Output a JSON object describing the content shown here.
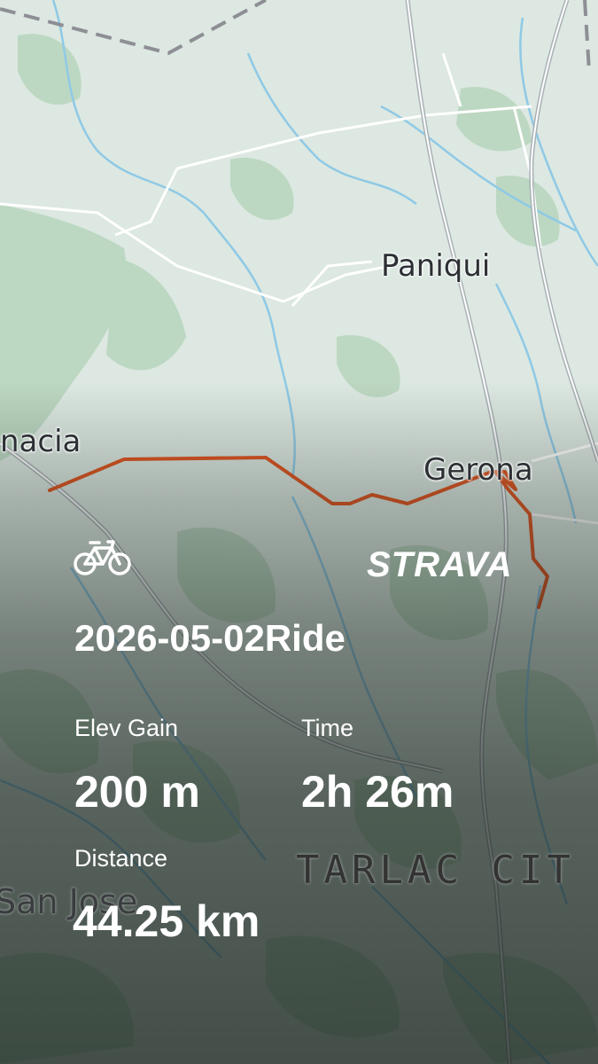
{
  "map": {
    "towns": {
      "paniqui": "Paniqui",
      "nacia": "nacia",
      "gerona": "Gerona",
      "tarlac": "TARLAC CIT",
      "san_jose": "San Jose"
    },
    "route_color": "#e0531f"
  },
  "activity": {
    "icon": "bike-icon",
    "brand": "STRAVA",
    "title": "2026-05-02Ride"
  },
  "stats": {
    "elev_gain": {
      "label": "Elev Gain",
      "value": "200 m"
    },
    "time": {
      "label": "Time",
      "value": "2h 26m"
    },
    "distance": {
      "label": "Distance",
      "value": "44.25 km"
    }
  },
  "colors": {
    "text": "#ffffff",
    "route": "#e0531f",
    "map_bg": "#d9e6df"
  }
}
